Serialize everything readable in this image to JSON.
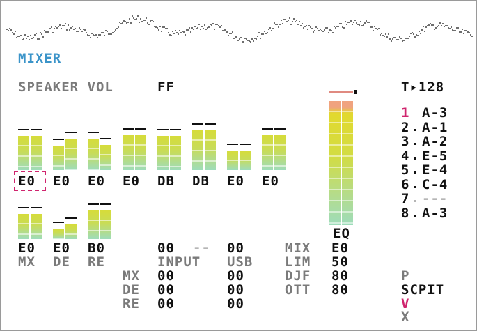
{
  "title": "MIXER",
  "speaker": {
    "label": "SPEAKER VOL",
    "value": "FF"
  },
  "tempo": "T▸128",
  "channels": [
    {
      "id": "ch1",
      "level": "E0",
      "left": 0.52,
      "right": 0.52,
      "selected": true
    },
    {
      "id": "ch2",
      "level": "E0",
      "left": 0.37,
      "right": 0.47,
      "selected": false
    },
    {
      "id": "ch3",
      "level": "E0",
      "left": 0.47,
      "right": 0.38,
      "selected": false
    },
    {
      "id": "ch4",
      "level": "E0",
      "left": 0.53,
      "right": 0.53,
      "selected": false
    },
    {
      "id": "ch5",
      "level": "DB",
      "left": 0.52,
      "right": 0.52,
      "selected": false
    },
    {
      "id": "ch6",
      "level": "DB",
      "left": 0.6,
      "right": 0.6,
      "selected": false
    },
    {
      "id": "ch7",
      "level": "E0",
      "left": 0.29,
      "right": 0.29,
      "selected": false
    },
    {
      "id": "ch8",
      "level": "E0",
      "left": 0.53,
      "right": 0.53,
      "selected": false
    }
  ],
  "returns": [
    {
      "name": "MX",
      "level": "E0",
      "left": 0.36,
      "right": 0.36
    },
    {
      "name": "DE",
      "level": "E0",
      "left": 0.15,
      "right": 0.21
    },
    {
      "name": "RE",
      "level": "B0",
      "left": 0.41,
      "right": 0.41
    }
  ],
  "master_label": "EQ",
  "master_left": 0.98,
  "master_right": 0.98,
  "input": {
    "label": "INPUT",
    "level": "00",
    "level2": "--",
    "mx": "00",
    "de": "00",
    "re": "00"
  },
  "usb": {
    "label": "USB",
    "level": "00",
    "mx": "00",
    "de": "00",
    "re": "00"
  },
  "rows": [
    "MX",
    "DE",
    "RE"
  ],
  "settings": [
    {
      "label": "MIX",
      "value": "E0"
    },
    {
      "label": "LIM",
      "value": "50"
    },
    {
      "label": "DJF",
      "value": "80"
    },
    {
      "label": "OTT",
      "value": "80"
    }
  ],
  "tracks": [
    {
      "num": "1",
      "chain": "A-3",
      "active": true
    },
    {
      "num": "2",
      "chain": "A-1",
      "active": false
    },
    {
      "num": "3",
      "chain": "A-2",
      "active": false
    },
    {
      "num": "4",
      "chain": "E-5",
      "active": false
    },
    {
      "num": "5",
      "chain": "E-4",
      "active": false
    },
    {
      "num": "6",
      "chain": "C-4",
      "active": false
    },
    {
      "num": "7",
      "chain": "---",
      "active": false
    },
    {
      "num": "8",
      "chain": "A-3",
      "active": false
    }
  ],
  "nav": [
    "P",
    "SCPIT",
    "V",
    "X"
  ],
  "colors": {
    "accent": "#d0256e",
    "title": "#3b94c9",
    "meter_top": "#d6dc3a",
    "meter_bottom": "#9edcbb"
  }
}
